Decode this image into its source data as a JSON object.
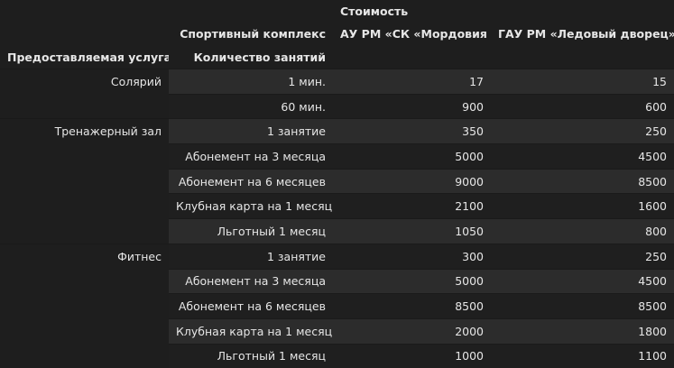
{
  "header": {
    "cost_label": "Стоимость",
    "sport_complex_label": "Спортивный комплекс",
    "complex_1": "АУ РМ «СК «Мордовия",
    "complex_2": "ГАУ РМ «Ледовый дворец»",
    "service_label": "Предоставляемая услуга",
    "sessions_label": "Количество занятий"
  },
  "groups": [
    {
      "service": "Солярий",
      "rows": [
        {
          "duration": "1 мин.",
          "v1": "17",
          "v2": "15"
        },
        {
          "duration": "60 мин.",
          "v1": "900",
          "v2": "600"
        }
      ]
    },
    {
      "service": "Тренажерный зал",
      "rows": [
        {
          "duration": "1 занятие",
          "v1": "350",
          "v2": "250"
        },
        {
          "duration": "Абонемент на 3 месяца",
          "v1": "5000",
          "v2": "4500"
        },
        {
          "duration": "Абонемент на 6 месяцев",
          "v1": "9000",
          "v2": "8500"
        },
        {
          "duration": "Клубная карта на 1 месяц",
          "v1": "2100",
          "v2": "1600"
        },
        {
          "duration": "Льготный 1 месяц",
          "v1": "1050",
          "v2": "800"
        }
      ]
    },
    {
      "service": "Фитнес",
      "rows": [
        {
          "duration": "1 занятие",
          "v1": "300",
          "v2": "250"
        },
        {
          "duration": "Абонемент на 3 месяца",
          "v1": "5000",
          "v2": "4500"
        },
        {
          "duration": "Абонемент на 6 месяцев",
          "v1": "8500",
          "v2": "8500"
        },
        {
          "duration": "Клубная карта на 1 месяц",
          "v1": "2000",
          "v2": "1800"
        },
        {
          "duration": "Льготный 1 месяц",
          "v1": "1000",
          "v2": "1100"
        }
      ]
    }
  ]
}
